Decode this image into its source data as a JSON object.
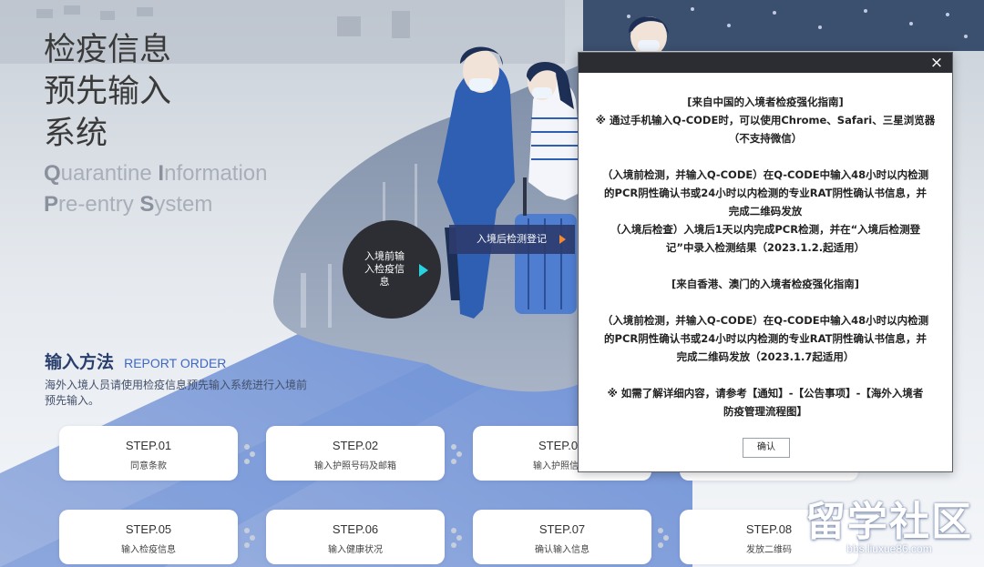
{
  "hero": {
    "title_lines": [
      "检疫信息",
      "预先输入",
      "系统"
    ],
    "en_line1": {
      "q": "Q",
      "uarantine": "uarantine ",
      "i": "I",
      "nformation": "nformation"
    },
    "en_line2": {
      "p": "P",
      "re_entry": "re-entry ",
      "s": "S",
      "ystem": "ystem"
    },
    "pre_entry_button": "入境前输入检疫信息",
    "post_entry_button": "入境后检测登记"
  },
  "method": {
    "title_cn": "输入方法",
    "title_en": "REPORT ORDER",
    "description": "海外入境人员请使用检疫信息预先输入系统进行入境前预先输入。"
  },
  "steps": [
    {
      "num": "STEP.01",
      "label": "同意条款"
    },
    {
      "num": "STEP.02",
      "label": "输入护照号码及邮箱"
    },
    {
      "num": "STEP.0",
      "label": "输入护照信"
    },
    {
      "num": "",
      "label": ""
    },
    {
      "num": "STEP.05",
      "label": "输入检疫信息"
    },
    {
      "num": "STEP.06",
      "label": "输入健康状况"
    },
    {
      "num": "STEP.07",
      "label": "确认输入信息"
    },
    {
      "num": "STEP.08",
      "label": "发放二维码"
    }
  ],
  "modal": {
    "close": "×",
    "lines": [
      "[来自中国的入境者检疫强化指南]",
      "※ 通过手机输入Q-CODE时，可以使用Chrome、Safari、三星浏览器",
      "（不支持微信）",
      "",
      "（入境前检测，并输入Q-CODE）在Q-CODE中输入48小时以内检测",
      "的PCR阴性确认书或24小时以内检测的专业RAT阴性确认书信息，并",
      "完成二维码发放",
      "（入境后检查）入境后1天以内完成PCR检测，并在“入境后检测登",
      "记”中录入检测结果（2023.1.2.起适用）",
      "",
      "[来自香港、澳门的入境者检疫强化指南]",
      "",
      "（入境前检测，并输入Q-CODE）在Q-CODE中输入48小时以内检测",
      "的PCR阴性确认书或24小时以内检测的专业RAT阴性确认书信息，并",
      "完成二维码发放（2023.1.7起适用）",
      "",
      "※ 如需了解详细内容，请参考【通知】-【公告事项】-【海外入境者",
      "防疫管理流程图】"
    ],
    "confirm": "确认"
  },
  "watermark": {
    "text": "留学社区",
    "url": "bbs.liuxue86.com"
  },
  "colors": {
    "accent_blue": "#3e68c4",
    "dark": "#2b2d33",
    "cyan_arrow": "#27d3e0",
    "orange_arrow": "#f28a2f"
  }
}
